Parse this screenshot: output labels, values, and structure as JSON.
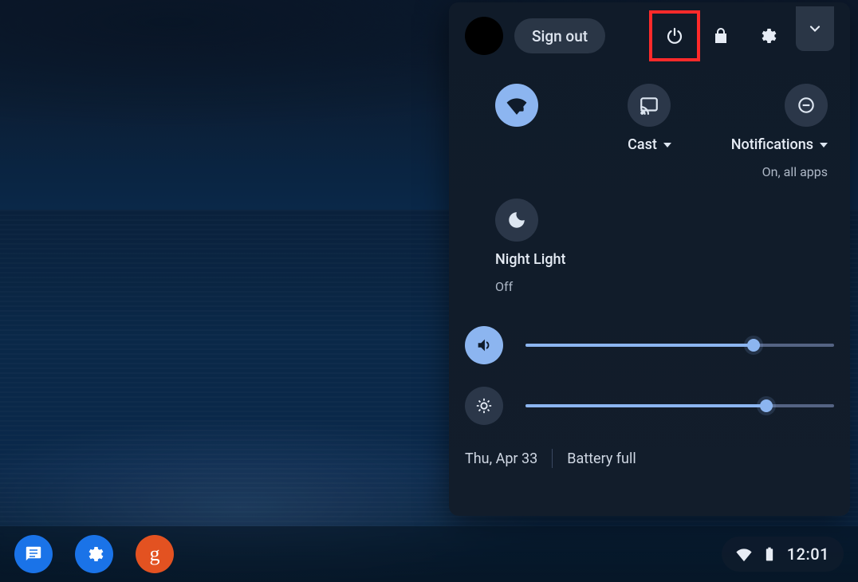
{
  "header": {
    "sign_out": "Sign out"
  },
  "toggles": {
    "network": {
      "label": "",
      "sub": ""
    },
    "cast": {
      "label": "Cast"
    },
    "notifications": {
      "label": "Notifications",
      "sub": "On, all apps"
    },
    "night_light": {
      "label": "Night Light",
      "sub": "Off"
    }
  },
  "sliders": {
    "volume_pct": 74,
    "brightness_pct": 78
  },
  "footer": {
    "date": "Thu, Apr 33",
    "battery": "Battery full"
  },
  "status": {
    "time": "12:01"
  }
}
